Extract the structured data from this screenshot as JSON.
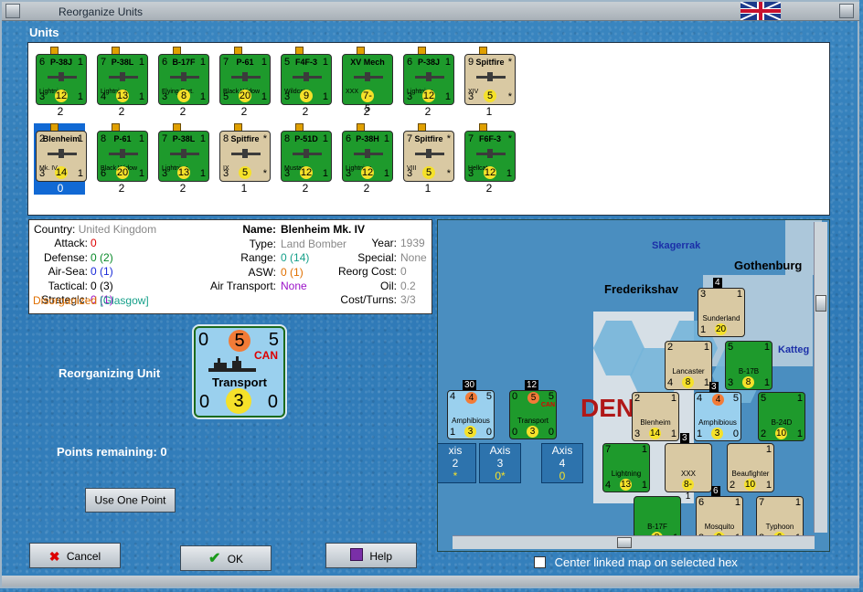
{
  "window": {
    "title": "Reorganize Units"
  },
  "units_section": {
    "label": "Units"
  },
  "units": [
    {
      "name": "P-38J",
      "type_label": "Lightning",
      "tl": "6",
      "tr": "1",
      "bl": "3",
      "circle": "12",
      "br": "1",
      "count": "2",
      "style": "green"
    },
    {
      "name": "P-38L",
      "type_label": "Lightning",
      "tl": "7",
      "tr": "1",
      "bl": "4",
      "circle": "13",
      "br": "1",
      "count": "2",
      "style": "green"
    },
    {
      "name": "B-17F",
      "type_label": "Flying Fort.",
      "tl": "6",
      "tr": "1",
      "bl": "3",
      "circle": "8",
      "br": "1",
      "count": "2",
      "style": "green"
    },
    {
      "name": "P-61",
      "type_label": "Black Widow",
      "tl": "7",
      "tr": "1",
      "bl": "5",
      "circle": "20",
      "br": "1",
      "count": "2",
      "style": "green"
    },
    {
      "name": "F4F-3",
      "type_label": "Wildcat",
      "tl": "5",
      "tr": "1",
      "bl": "3",
      "circle": "9",
      "br": "1",
      "count": "2",
      "style": "green"
    },
    {
      "name": "XV Mech",
      "type_label": "XXX",
      "tl": "",
      "tr": "",
      "bl": "",
      "circle": "7-5",
      "br": "",
      "count": "2",
      "style": "green"
    },
    {
      "name": "P-38J",
      "type_label": "Lightning",
      "tl": "6",
      "tr": "1",
      "bl": "3",
      "circle": "12",
      "br": "1",
      "count": "2",
      "style": "green"
    },
    {
      "name": "Spitfire",
      "type_label": "XIV",
      "tl": "9",
      "tr": "*",
      "bl": "3",
      "circle": "5",
      "br": "*",
      "count": "1",
      "style": "tan"
    },
    {
      "name": "Blenheim",
      "type_label": "Mk. IV",
      "tl": "2",
      "tr": "1",
      "bl": "3",
      "circle": "14",
      "br": "1",
      "count": "0",
      "style": "tan"
    },
    {
      "name": "P-61",
      "type_label": "Black Widow",
      "tl": "8",
      "tr": "1",
      "bl": "6",
      "circle": "20",
      "br": "1",
      "count": "2",
      "style": "green"
    },
    {
      "name": "P-38L",
      "type_label": "Lightning",
      "tl": "7",
      "tr": "1",
      "bl": "3",
      "circle": "13",
      "br": "1",
      "count": "2",
      "style": "green"
    },
    {
      "name": "Spitfire",
      "type_label": "IX",
      "tl": "8",
      "tr": "*",
      "bl": "3",
      "circle": "5",
      "br": "*",
      "count": "1",
      "style": "tan"
    },
    {
      "name": "P-51D",
      "type_label": "Mustang",
      "tl": "8",
      "tr": "1",
      "bl": "3",
      "circle": "12",
      "br": "1",
      "count": "2",
      "style": "green"
    },
    {
      "name": "P-38H",
      "type_label": "Lightning",
      "tl": "6",
      "tr": "1",
      "bl": "3",
      "circle": "12",
      "br": "1",
      "count": "2",
      "style": "green"
    },
    {
      "name": "Spitfire",
      "type_label": "VIII",
      "tl": "7",
      "tr": "*",
      "bl": "3",
      "circle": "5",
      "br": "*",
      "count": "1",
      "style": "tan"
    },
    {
      "name": "F6F-3",
      "type_label": "Hellcat",
      "tl": "7",
      "tr": "*",
      "bl": "3",
      "circle": "12",
      "br": "1",
      "count": "2",
      "style": "green"
    }
  ],
  "info": {
    "country_label": "Country:",
    "country_value": "United Kingdom",
    "attack_label": "Attack:",
    "attack_value": "0",
    "defense_label": "Defense:",
    "defense_value": "0",
    "defense_paren": "(2)",
    "airsea_label": "Air-Sea:",
    "airsea_value": "0",
    "airsea_paren": "(1)",
    "tactical_label": "Tactical:",
    "tactical_value": "0",
    "tactical_paren": "(3)",
    "strategic_label": "Strategic:",
    "strategic_value": "0",
    "strategic_paren": "(1)",
    "status": "Disorganized",
    "location": "[Glasgow]",
    "name_label": "Name:",
    "name_value": "Blenheim Mk. IV",
    "type_label": "Type:",
    "type_value": "Land Bomber",
    "year_label": "Year:",
    "year_value": "1939",
    "range_label": "Range:",
    "range_value": "0",
    "range_paren": "(14)",
    "special_label": "Special:",
    "special_value": "None",
    "asw_label": "ASW:",
    "asw_value": "0",
    "asw_paren": "(1)",
    "reorg_label": "Reorg Cost:",
    "reorg_value": "0",
    "airtransport_label": "Air Transport:",
    "airtransport_value": "None",
    "oil_label": "Oil:",
    "oil_value": "0.2",
    "costturns_label": "Cost/Turns:",
    "costturns_value": "3/3"
  },
  "reorganizing": {
    "label": "Reorganizing Unit",
    "counter": {
      "tl": "0",
      "center": "5",
      "tr": "5",
      "nation": "CAN",
      "name": "Transport",
      "bl": "0",
      "bc": "3",
      "br": "0"
    }
  },
  "points": {
    "label": "Points remaining:",
    "value": "0"
  },
  "buttons": {
    "use_one_point": "Use One Point",
    "cancel": "Cancel",
    "ok": "OK",
    "help": "Help"
  },
  "map": {
    "labels": {
      "skagerrak": "Skagerrak",
      "gothenburg": "Gothenburg",
      "frederikshavn": "Frederikshav",
      "kattegat": "Katteg",
      "denmark_1": "DEN",
      "denmark_2": "R"
    },
    "counters": [
      {
        "id": "amph1",
        "tl": "4",
        "oc": "4",
        "tr": "5",
        "name": "Amphibious",
        "bl": "1",
        "yc": "3",
        "br": "0",
        "stack": "30"
      },
      {
        "id": "trans1",
        "tl": "0",
        "oc": "5",
        "tr": "5",
        "name": "Transport",
        "bl": "0",
        "yc": "3",
        "br": "0",
        "stack": "12",
        "nation": "CAN"
      },
      {
        "id": "sunderland",
        "tl": "3",
        "oc": "",
        "tr": "1",
        "name": "Sunderland",
        "bl": "1",
        "yc": "20",
        "br": "",
        "stack": "4"
      },
      {
        "id": "lancaster",
        "tl": "2",
        "oc": "",
        "tr": "1",
        "name": "Lancaster",
        "bl": "4",
        "yc": "8",
        "br": "1",
        "stack": ""
      },
      {
        "id": "b17b",
        "tl": "5",
        "oc": "",
        "tr": "1",
        "name": "B-17B",
        "bl": "3",
        "yc": "8",
        "br": "1",
        "stack": ""
      },
      {
        "id": "blenheim",
        "tl": "2",
        "oc": "",
        "tr": "1",
        "name": "Blenheim",
        "bl": "3",
        "yc": "14",
        "br": "1",
        "stack": ""
      },
      {
        "id": "amph2",
        "tl": "4",
        "oc": "4",
        "tr": "5",
        "name": "Amphibious",
        "bl": "1",
        "yc": "3",
        "br": "0",
        "stack": "3"
      },
      {
        "id": "b24d",
        "tl": "5",
        "oc": "",
        "tr": "1",
        "name": "B-24D",
        "bl": "2",
        "yc": "10",
        "br": "1",
        "stack": ""
      },
      {
        "id": "p38l",
        "tl": "7",
        "oc": "",
        "tr": "1",
        "name": "Lightning",
        "bl": "4",
        "yc": "13",
        "br": "1",
        "stack": ""
      },
      {
        "id": "xxx",
        "tl": "",
        "oc": "",
        "tr": "",
        "name": "XXX",
        "bl": "",
        "yc": "8-1",
        "br": "",
        "stack": "3"
      },
      {
        "id": "beaufighter",
        "tl": "",
        "oc": "",
        "tr": "1",
        "name": "Beaufighter",
        "bl": "2",
        "yc": "10",
        "br": "1",
        "stack": ""
      },
      {
        "id": "mosquito",
        "tl": "6",
        "oc": "",
        "tr": "1",
        "name": "Mosquito",
        "bl": "3",
        "yc": "9",
        "br": "1",
        "stack": "6"
      },
      {
        "id": "typhoon",
        "tl": "7",
        "oc": "",
        "tr": "1",
        "name": "Typhoon",
        "bl": "3",
        "yc": "6",
        "br": "1",
        "stack": ""
      },
      {
        "id": "b17f",
        "tl": "",
        "oc": "",
        "tr": "",
        "name": "B-17F",
        "bl": "",
        "yc": "8",
        "br": "1",
        "stack": ""
      }
    ],
    "axis_boxes": [
      {
        "label": "xis",
        "num": "2",
        "sub": "*"
      },
      {
        "label": "Axis",
        "num": "3",
        "sub": "0*"
      },
      {
        "label": "Axis",
        "num": "4",
        "sub": "0"
      }
    ],
    "center_checkbox_label": "Center linked map on selected hex"
  },
  "colors": {
    "accent_water": "#2f7ab7",
    "unit_green": "#1e9a2c",
    "unit_tan": "#d9c9a3",
    "selection": "#1169d4"
  }
}
